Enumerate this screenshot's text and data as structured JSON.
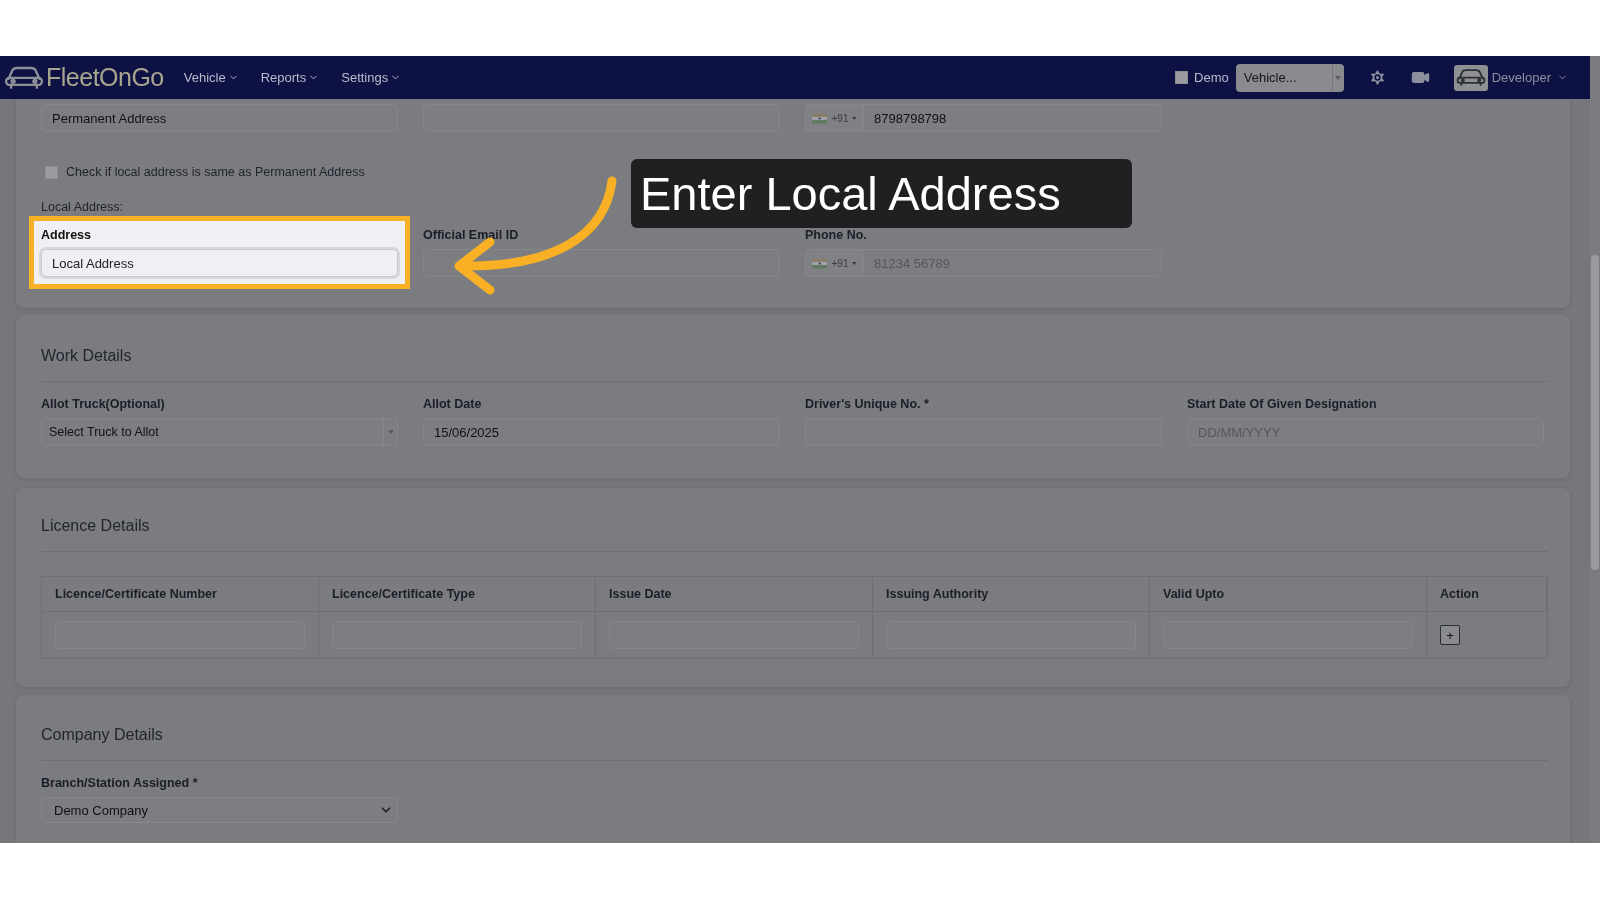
{
  "navbar": {
    "logo": "FleetOnGo",
    "menus": [
      {
        "label": "Vehicle"
      },
      {
        "label": "Reports"
      },
      {
        "label": "Settings"
      }
    ],
    "demo": {
      "label": "Demo",
      "checked": false
    },
    "vehicle_select": {
      "value": "Vehicle..."
    },
    "user": {
      "label": "Developer"
    }
  },
  "permanent_row": [
    {
      "kind": "text",
      "value": "Permanent Address"
    },
    {
      "kind": "text"
    },
    {
      "kind": "phone",
      "code": "+91",
      "value": "8798798798"
    }
  ],
  "same_address": {
    "label": "Check if local address is same as Permanent Address",
    "checked": false
  },
  "local_address": {
    "heading": "Local Address:",
    "fields": [
      {
        "kind": "text",
        "label": "Address",
        "value": "Local Address",
        "highlighted": true
      },
      {
        "kind": "text",
        "label": "Official Email ID",
        "highlighted": false
      },
      {
        "kind": "phone",
        "label": "Phone No.",
        "code": "+91",
        "placeholder": "81234 56789",
        "highlighted": false
      }
    ]
  },
  "work_details": {
    "title": "Work Details",
    "fields": [
      {
        "kind": "select",
        "label": "Allot Truck(Optional)",
        "value": "Select Truck to Allot"
      },
      {
        "kind": "text",
        "label": "Allot Date",
        "value": "15/06/2025"
      },
      {
        "kind": "text",
        "label": "Driver's Unique No. *"
      },
      {
        "kind": "text",
        "label": "Start Date Of Given Designation",
        "placeholder": "DD/MM/YYYY"
      }
    ]
  },
  "licence_details": {
    "title": "Licence Details",
    "columns": [
      "Licence/Certificate Number",
      "Licence/Certificate Type",
      "Issue Date",
      "Issuing Authority",
      "Valid Upto",
      "Action"
    ],
    "rows": [
      {
        "action": "+"
      }
    ]
  },
  "company_details": {
    "title": "Company Details",
    "fields": [
      {
        "kind": "native_select",
        "label": "Branch/Station Assigned *",
        "value": "Demo Company"
      }
    ]
  },
  "callout": {
    "text": "Enter Local Address"
  }
}
